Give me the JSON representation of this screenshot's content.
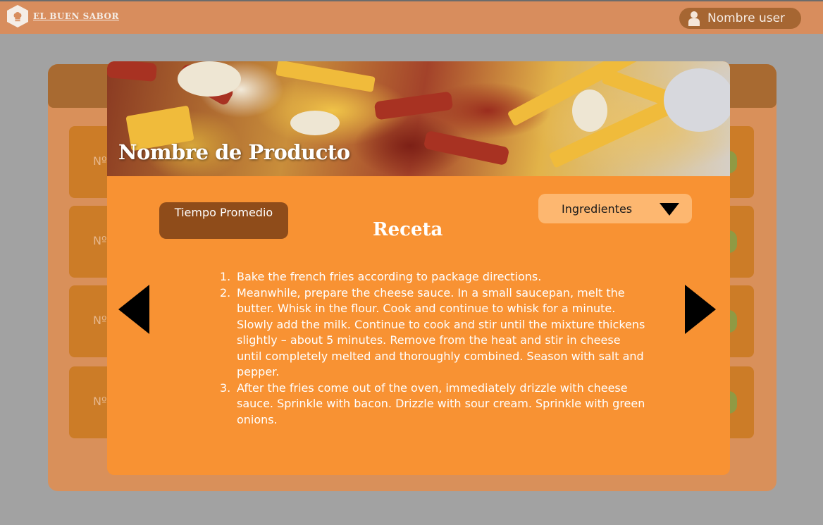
{
  "brand": {
    "name": "EL BUEN SABOR",
    "logo_icon": "chef-hat-icon"
  },
  "user": {
    "name": "Nombre user",
    "icon": "user-icon"
  },
  "background_list": {
    "items": [
      {
        "label": "Nº"
      },
      {
        "label": "Nº"
      },
      {
        "label": "Nº"
      },
      {
        "label": "Nº"
      }
    ]
  },
  "modal": {
    "product_name": "Nombre de Producto",
    "tiempo_label": "Tiempo Promedio",
    "recipe_title": "Receta",
    "ingredients_dropdown": "Ingredientes",
    "steps": [
      {
        "num": "1.",
        "text": "Bake the french fries according to package directions."
      },
      {
        "num": "2.",
        "text": "Meanwhile, prepare the cheese sauce. In a small saucepan, melt the butter. Whisk in the flour. Cook and continue to whisk for a minute. Slowly add the milk. Continue to cook and stir until the mixture thickens slightly – about 5 minutes. Remove from the heat and stir in cheese until completely melted and thoroughly combined. Season with salt and pepper."
      },
      {
        "num": "3.",
        "text": "After the fries come out of the oven, immediately drizzle with cheese sauce. Sprinkle with bacon. Drizzle with sour cream. Sprinkle with green onions."
      }
    ]
  },
  "colors": {
    "topbar": "#d88d5d",
    "modal": "#f89233",
    "tiempo_button": "#8f4c1a",
    "dropdown": "#fdb770",
    "overlay": "#a2a2a2"
  }
}
